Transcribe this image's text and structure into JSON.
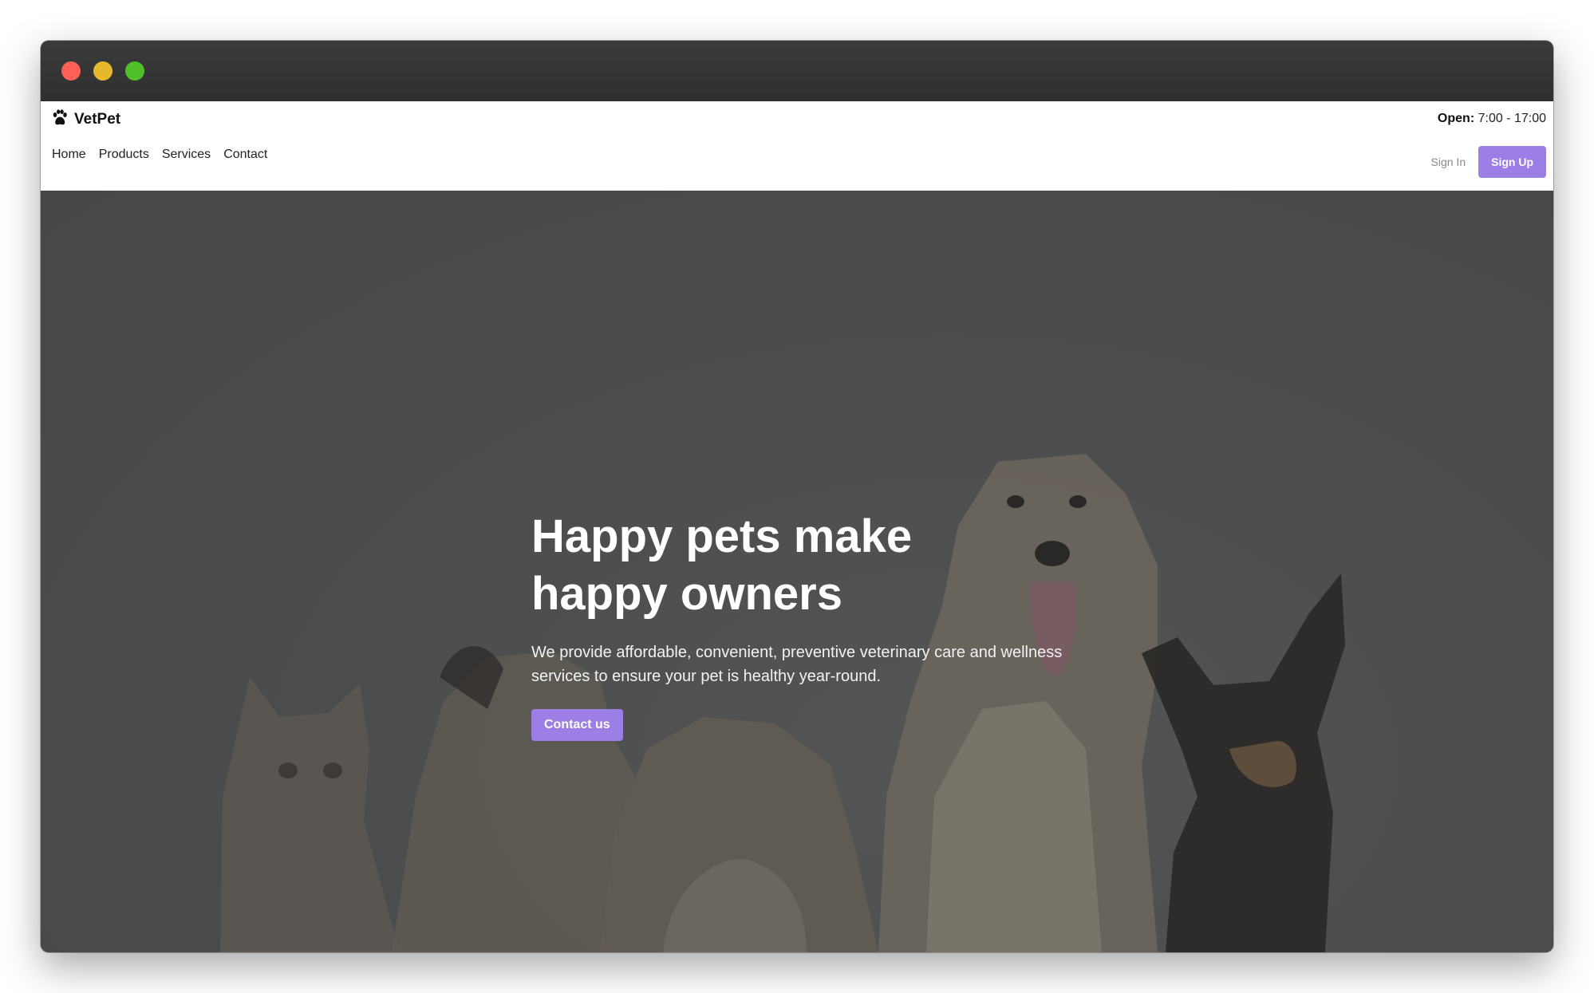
{
  "brand": {
    "name": "VetPet",
    "icon": "paw-icon"
  },
  "hours": {
    "label": "Open:",
    "value": "7:00 - 17:00"
  },
  "nav": {
    "items": [
      "Home",
      "Products",
      "Services",
      "Contact"
    ]
  },
  "auth": {
    "sign_in": "Sign In",
    "sign_up": "Sign Up"
  },
  "hero": {
    "title": "Happy pets make happy owners",
    "text": "We provide affordable, convenient, preventive veterinary care and wellness services to ensure your pet is healthy year-round.",
    "cta": "Contact us"
  },
  "colors": {
    "accent": "#9b7ee6",
    "hero_overlay": "#4a4a4a"
  }
}
